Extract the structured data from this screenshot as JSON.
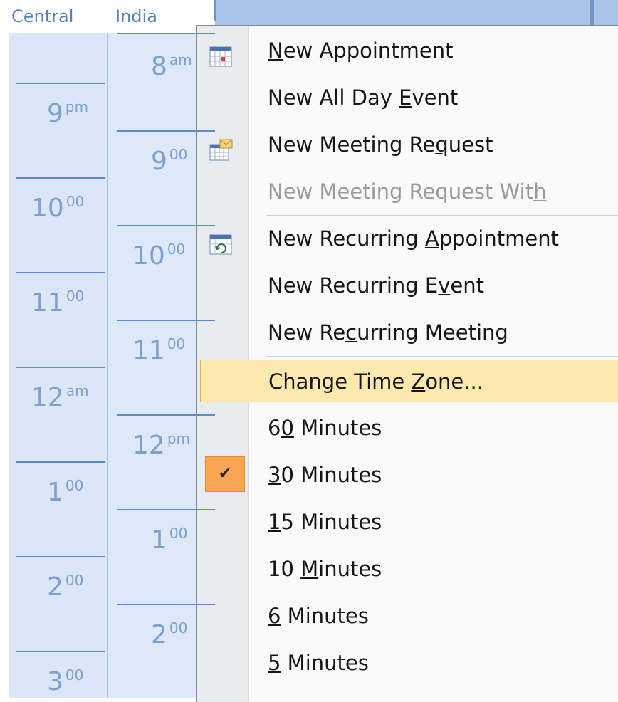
{
  "timezones": {
    "central_label": "Central",
    "india_label": "India"
  },
  "central_hours": [
    {
      "h": "9",
      "s": "pm"
    },
    {
      "h": "10",
      "s": "00"
    },
    {
      "h": "11",
      "s": "00"
    },
    {
      "h": "12",
      "s": "am"
    },
    {
      "h": "1",
      "s": "00"
    },
    {
      "h": "2",
      "s": "00"
    },
    {
      "h": "3",
      "s": "00"
    }
  ],
  "india_hours": [
    {
      "h": "8",
      "s": "am"
    },
    {
      "h": "9",
      "s": "00"
    },
    {
      "h": "10",
      "s": "00"
    },
    {
      "h": "11",
      "s": "00"
    },
    {
      "h": "12",
      "s": "pm"
    },
    {
      "h": "1",
      "s": "00"
    },
    {
      "h": "2",
      "s": "00"
    }
  ],
  "menu": {
    "items": [
      {
        "pre": "",
        "key": "N",
        "post": "ew Appointment",
        "icon": "new-appointment-icon"
      },
      {
        "pre": "New All Day ",
        "key": "E",
        "post": "vent",
        "icon": ""
      },
      {
        "pre": "New Meeting Re",
        "key": "q",
        "post": "uest",
        "icon": "new-meeting-request-icon"
      },
      {
        "pre": "New Meeting Request Wit",
        "key": "h",
        "post": "",
        "icon": "",
        "disabled": true
      },
      {
        "pre": "New Recurring ",
        "key": "A",
        "post": "ppointment",
        "icon": "new-recurring-appointment-icon"
      },
      {
        "pre": "New Recurring E",
        "key": "v",
        "post": "ent",
        "icon": ""
      },
      {
        "pre": "New Re",
        "key": "c",
        "post": "urring Meeting",
        "icon": ""
      },
      {
        "pre": "Change Time ",
        "key": "Z",
        "post": "one...",
        "icon": "",
        "highlight": true
      },
      {
        "pre": "6",
        "key": "0",
        "post": " Minutes",
        "icon": ""
      },
      {
        "pre": "",
        "key": "3",
        "post": "0 Minutes",
        "icon": "checkmark-icon",
        "checked": true
      },
      {
        "pre": "",
        "key": "1",
        "post": "5 Minutes",
        "icon": ""
      },
      {
        "pre": "10 ",
        "key": "M",
        "post": "inutes",
        "icon": ""
      },
      {
        "pre": "",
        "key": "6",
        "post": " Minutes",
        "icon": ""
      },
      {
        "pre": "",
        "key": "5",
        "post": " Minutes",
        "icon": ""
      }
    ]
  },
  "colors": {
    "ruler_bg": "#dbe7f8",
    "hour_line": "#5d8cc9",
    "hour_text": "#7f9fcc",
    "highlight_bg": "#fde9ad",
    "check_bg": "#f8a653"
  }
}
